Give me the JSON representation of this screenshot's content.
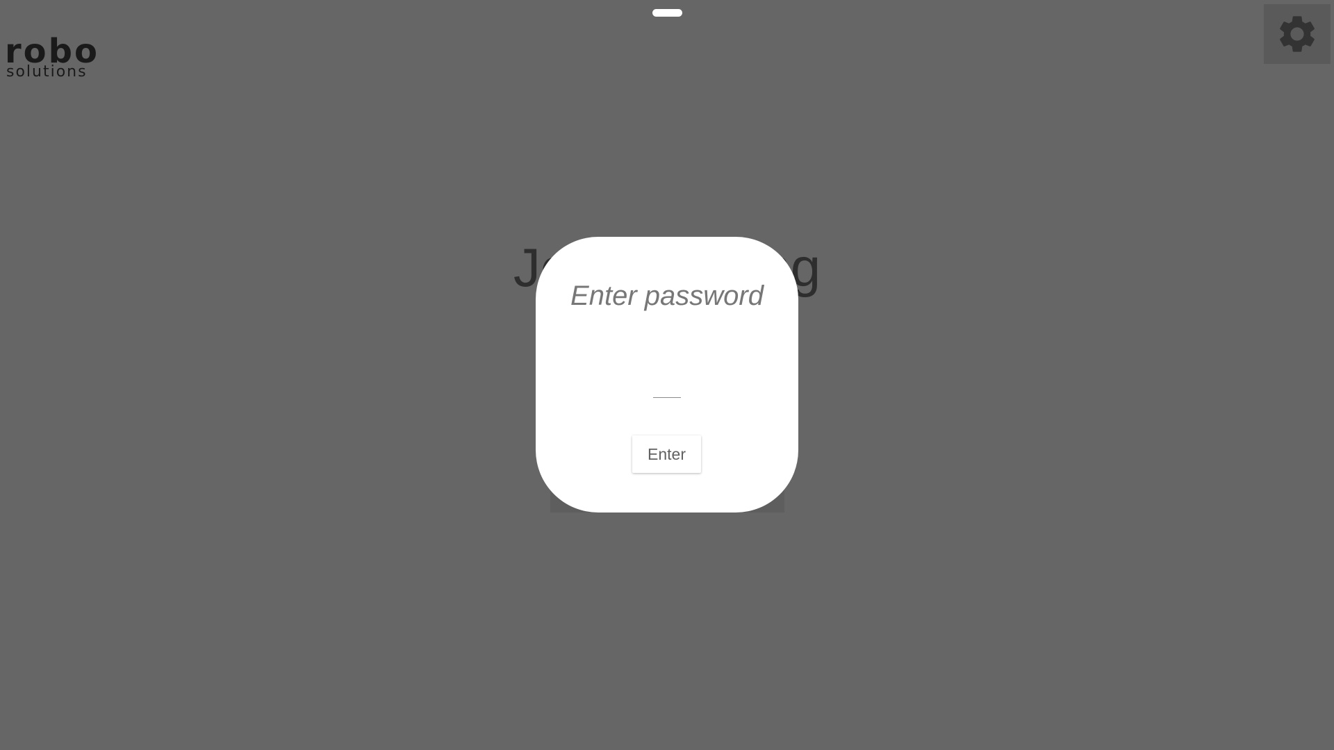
{
  "app": {
    "logo_text": "robo",
    "logo_subtext": "solutions",
    "settings_icon": "gear-icon",
    "icon_color": "#333333"
  },
  "background_title": "Join meeting",
  "dialog": {
    "title": "Enter password",
    "input_value": "",
    "enter_label": "Enter"
  },
  "colors": {
    "background": "#666666",
    "dialog": "#ffffff",
    "logo_accent": "#1f5a4e"
  }
}
